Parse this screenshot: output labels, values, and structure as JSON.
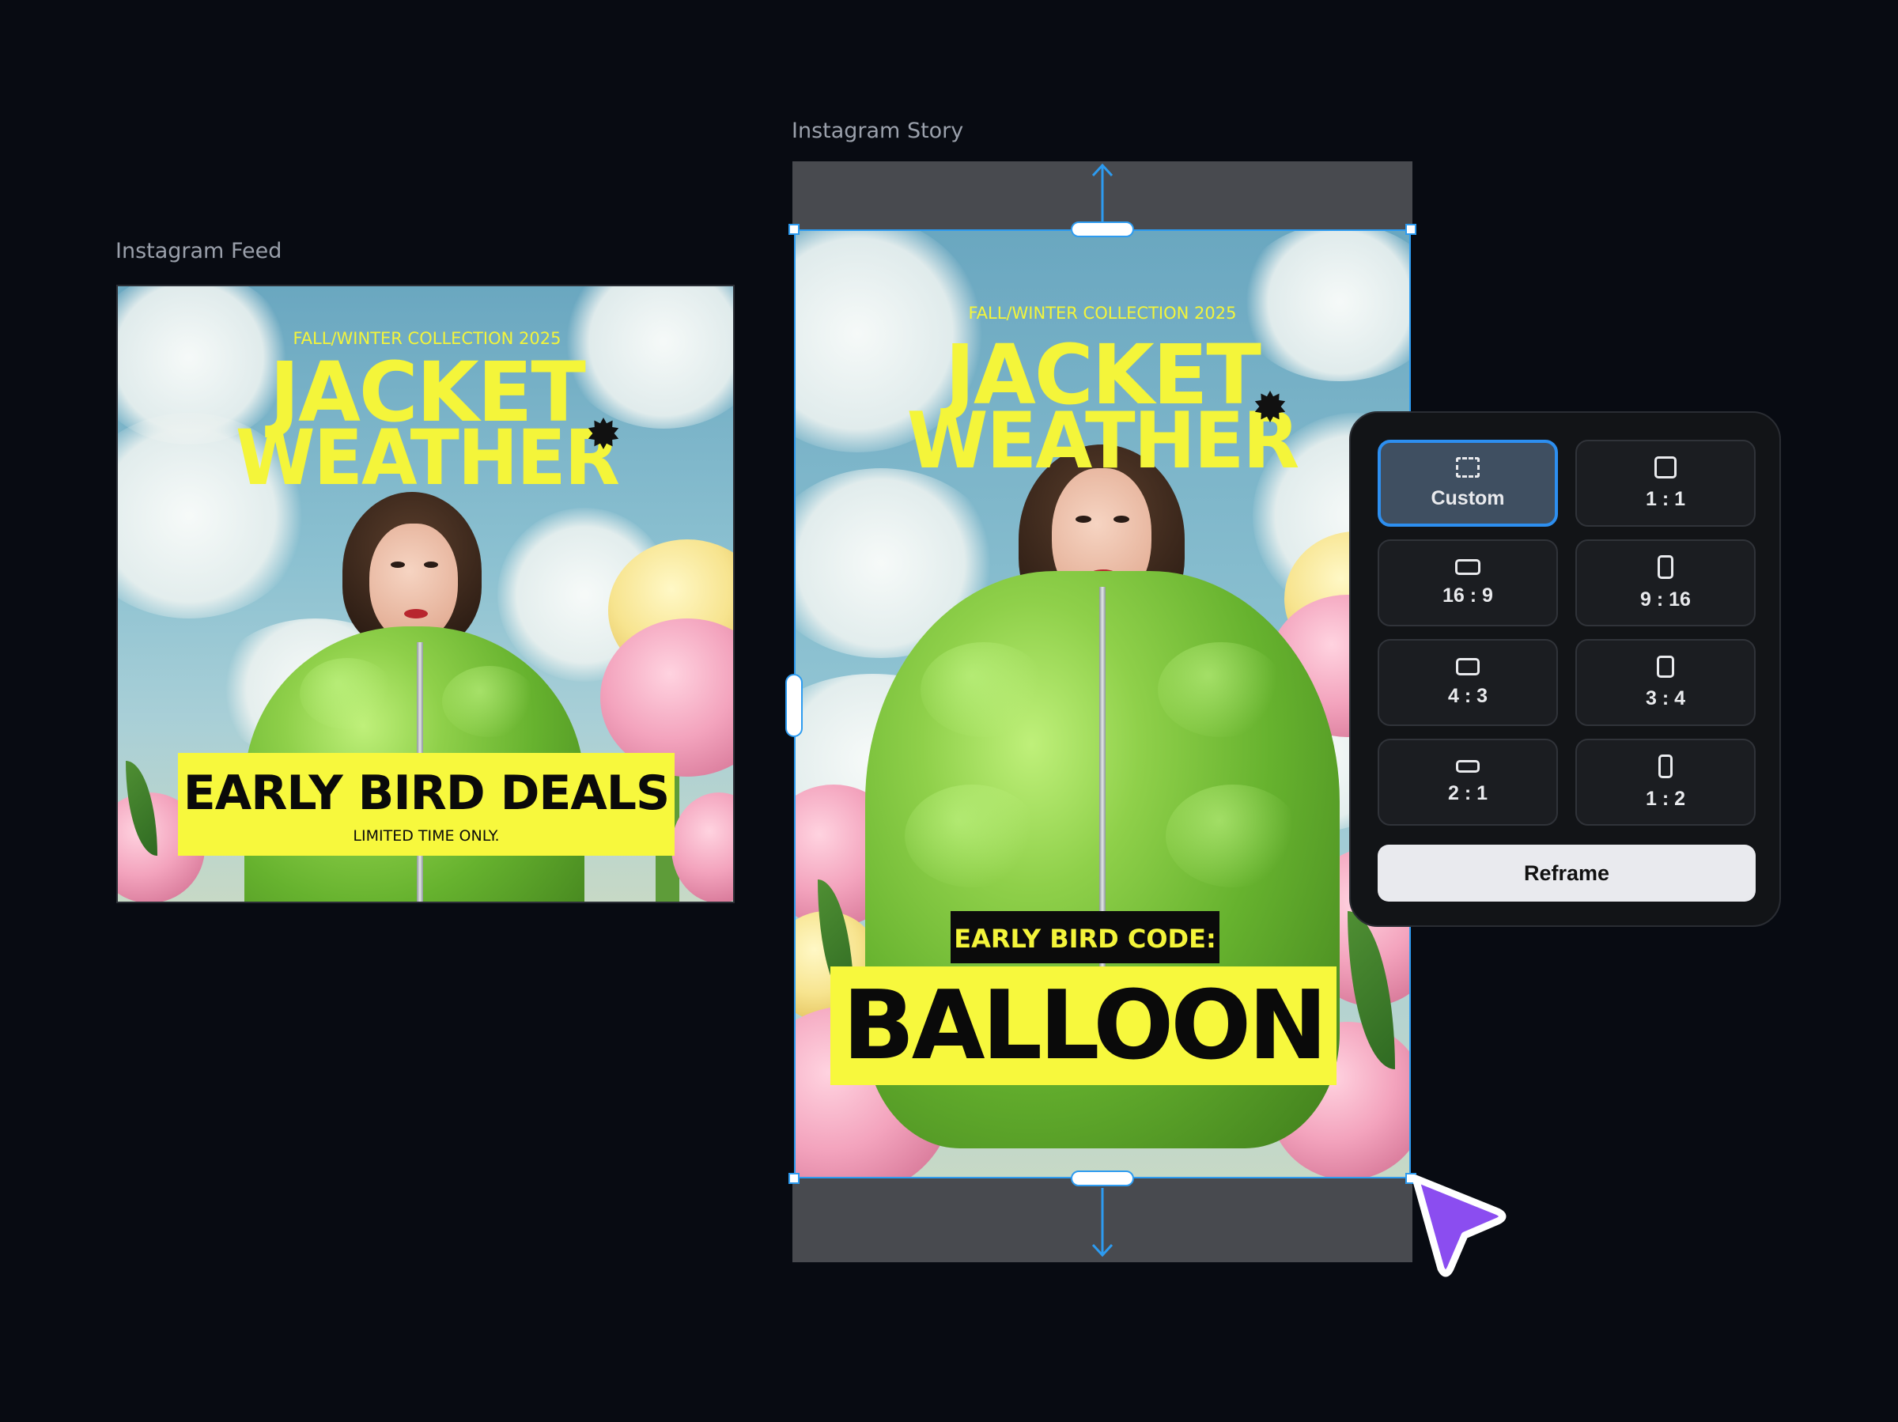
{
  "canvas": {
    "background": "#080b12"
  },
  "frames": {
    "feed": {
      "label": "Instagram Feed",
      "artwork": {
        "collection": "FALL/WINTER COLLECTION 2025",
        "title_line1": "JACKET",
        "title_line2": "WEATHER",
        "banner_headline": "EARLY BIRD DEALS",
        "banner_subline": "LIMITED TIME ONLY."
      }
    },
    "story": {
      "label": "Instagram Story",
      "artwork": {
        "collection": "FALL/WINTER COLLECTION 2025",
        "title_line1": "JACKET",
        "title_line2": "WEATHER",
        "code_label": "EARLY BIRD CODE:",
        "code_value": "BALLOON"
      }
    }
  },
  "aspect_panel": {
    "options": [
      {
        "label": "Custom",
        "icon": "dashed-frame-icon",
        "selected": true
      },
      {
        "label": "1 : 1",
        "icon": "square-icon"
      },
      {
        "label": "16 : 9",
        "icon": "landscape-16-9-icon"
      },
      {
        "label": "9 : 16",
        "icon": "portrait-9-16-icon"
      },
      {
        "label": "4 : 3",
        "icon": "landscape-4-3-icon"
      },
      {
        "label": "3 : 4",
        "icon": "portrait-3-4-icon"
      },
      {
        "label": "2 : 1",
        "icon": "landscape-2-1-icon"
      },
      {
        "label": "1 : 2",
        "icon": "portrait-1-2-icon"
      }
    ],
    "action": "Reframe"
  },
  "colors": {
    "accent_yellow": "#f4f53a",
    "selection_blue": "#2d9bf0",
    "cursor_purple": "#8b4df0"
  }
}
